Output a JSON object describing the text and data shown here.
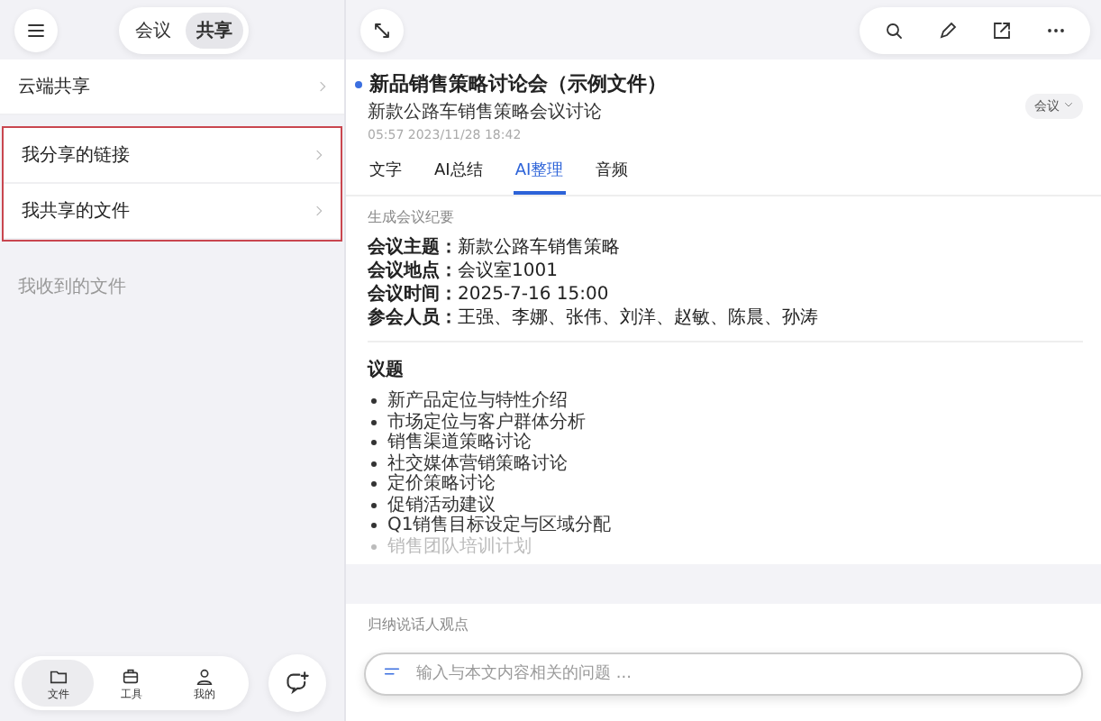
{
  "left_panel": {
    "mode_switch": [
      {
        "label": "会议",
        "selected": false
      },
      {
        "label": "共享",
        "selected": true
      }
    ],
    "items": [
      {
        "label": "云端共享",
        "highlighted": false
      },
      {
        "label": "我分享的链接",
        "highlighted": true
      },
      {
        "label": "我共享的文件",
        "highlighted": true
      }
    ],
    "section_label": "我收到的文件",
    "bottom_nav": [
      {
        "label": "文件",
        "selected": true
      },
      {
        "label": "工具",
        "selected": false
      },
      {
        "label": "我的",
        "selected": false
      }
    ]
  },
  "document": {
    "title": "新品销售策略讨论会（示例文件）",
    "subtitle": "新款公路车销售策略会议讨论",
    "meta": "05:57  2023/11/28 18:42",
    "category": "会议",
    "tabs": [
      {
        "label": "文字",
        "selected": false
      },
      {
        "label": "AI总结",
        "selected": false
      },
      {
        "label": "AI整理",
        "selected": true
      },
      {
        "label": "音频",
        "selected": false
      }
    ]
  },
  "minutes_card": {
    "heading": "生成会议纪要",
    "fields": [
      {
        "label": "会议主题：",
        "value": "新款公路车销售策略"
      },
      {
        "label": "会议地点：",
        "value": "会议室1001"
      },
      {
        "label": "会议时间：",
        "value": "2025-7-16 15:00"
      },
      {
        "label": "参会人员：",
        "value": "王强、李娜、张伟、刘洋、赵敏、陈晨、孙涛"
      }
    ],
    "topics_heading": "议题",
    "topics": [
      "新产品定位与特性介绍",
      "市场定位与客户群体分析",
      "销售渠道策略讨论",
      "社交媒体营销策略讨论",
      "定价策略讨论",
      "促销活动建议",
      "Q1销售目标设定与区域分配",
      "销售团队培训计划"
    ]
  },
  "speakers_card": {
    "heading": "归纳说话人观点"
  },
  "ask_bar": {
    "placeholder": "输入与本文内容相关的问题 ..."
  }
}
